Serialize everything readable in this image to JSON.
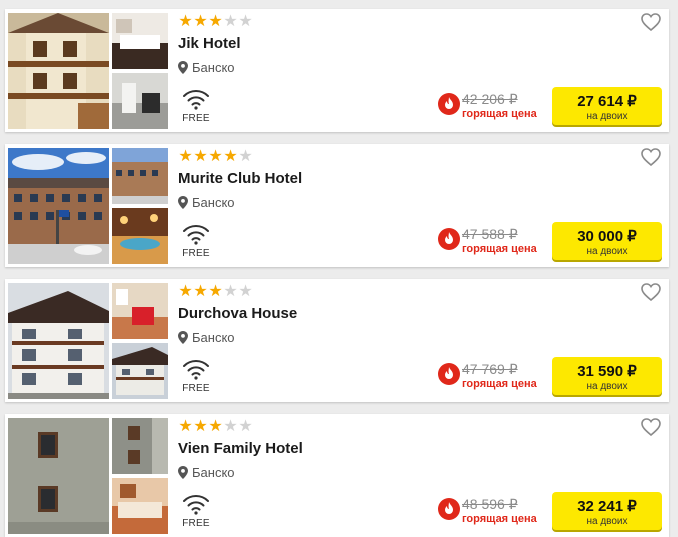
{
  "colors": {
    "star_on": "#f6a800",
    "star_off": "#d2d2d2",
    "hot": "#e0281a",
    "button": "#fde800"
  },
  "hotels": [
    {
      "stars": 3,
      "max_stars": 5,
      "name": "Jik Hotel",
      "location": "Банско",
      "wifi_label": "FREE",
      "old_price": "42 206 ₽",
      "hot_label": "горящая цена",
      "price": "27 614 ₽",
      "price_note": "на двоих"
    },
    {
      "stars": 4,
      "max_stars": 5,
      "name": "Murite Club Hotel",
      "location": "Банско",
      "wifi_label": "FREE",
      "old_price": "47 588 ₽",
      "hot_label": "горящая цена",
      "price": "30 000 ₽",
      "price_note": "на двоих"
    },
    {
      "stars": 3,
      "max_stars": 5,
      "name": "Durchova House",
      "location": "Банско",
      "wifi_label": "FREE",
      "old_price": "47 769 ₽",
      "hot_label": "горящая цена",
      "price": "31 590 ₽",
      "price_note": "на двоих"
    },
    {
      "stars": 3,
      "max_stars": 5,
      "name": "Vien Family Hotel",
      "location": "Банско",
      "wifi_label": "FREE",
      "old_price": "48 596 ₽",
      "hot_label": "горящая цена",
      "price": "32 241 ₽",
      "price_note": "на двоих"
    }
  ]
}
